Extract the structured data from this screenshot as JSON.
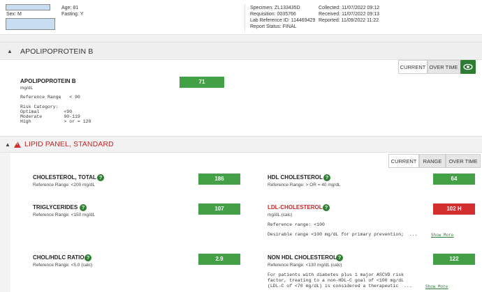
{
  "patient": {
    "sex": "Sex: M",
    "age": "Age: 81",
    "fasting": "Fasting: Y",
    "specimen": "Specimen: ZL133435D",
    "requisition": "Requisition: 0035766",
    "lab_ref": "Lab Reference ID: 114469429",
    "status": "Report Status: FINAL",
    "collected": "Collected: 11/07/2022 09:12",
    "received": "Received: 11/07/2022 09:13",
    "reported": "Reported: 11/09/2022 11:22"
  },
  "apo": {
    "title": "APOLIPOPROTEIN B",
    "tab_current": "CURRENT",
    "tab_overtime": "OVER TIME",
    "test_name": "APOLIPOPROTEIN B",
    "unit": "mg/dL",
    "value": "71",
    "ref_range": "Reference Range   < 90",
    "risk_header": "Risk Category:",
    "risk_rows": [
      "Optimal         <90",
      "Moderate        90-119",
      "High            > or = 120"
    ]
  },
  "lipid": {
    "title": "LIPID PANEL, STANDARD",
    "tab_current": "CURRENT",
    "tab_range": "RANGE",
    "tab_overtime": "OVER TIME",
    "cholesterol": {
      "name": "CHOLESTEROL, TOTAL",
      "ref": "Reference Range: <200 mg/dL",
      "value": "186"
    },
    "hdl": {
      "name": "HDL CHOLESTEROL",
      "ref": "Reference Range: > OR = 40 mg/dL",
      "value": "64"
    },
    "trig": {
      "name": "TRIGLYCERIDES",
      "ref": "Reference Range: <150 mg/dL",
      "value": "107"
    },
    "ldl": {
      "name": "LDL-CHOLESTEROL",
      "unit": "mg/dL (calc)",
      "value": "102 H",
      "ref": "Reference range: <100",
      "note": "Desirable range <100 mg/dL for primary prevention;  ...",
      "show_more": "Show More"
    },
    "ratio": {
      "name": "CHOL/HDLC RATIO",
      "ref": "Reference Range: <5.0 (calc)",
      "value": "2.9"
    },
    "nonhdl": {
      "name": "NON HDL CHOLESTEROL",
      "ref": "Reference Range: <130 mg/dL (calc)",
      "value": "122",
      "note_lines": [
        "For patients with diabetes plus 1 major ASCVD risk",
        "factor, treating to a non-HDL-C goal of <100 mg/dL",
        "(LDL-C of <70 mg/dL) is considered a therapeutic  ..."
      ],
      "show_more": "Show More"
    }
  },
  "colors": {
    "green": "#43a047",
    "red": "#d32f2f",
    "header_gray": "#efefef"
  },
  "icons": {
    "help": "?",
    "chevron_up": "▲",
    "warning": "warning-triangle-icon",
    "eye": "eye-icon"
  }
}
